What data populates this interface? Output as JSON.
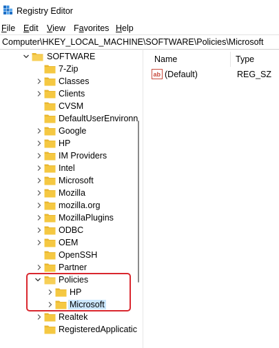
{
  "window": {
    "title": "Registry Editor"
  },
  "menu": [
    {
      "underline": "F",
      "rest": "ile"
    },
    {
      "underline": "E",
      "rest": "dit"
    },
    {
      "underline": "V",
      "rest": "iew"
    },
    {
      "prefix": "F",
      "underline": "a",
      "rest": "vorites"
    },
    {
      "underline": "H",
      "rest": "elp"
    }
  ],
  "address": {
    "path": "Computer\\HKEY_LOCAL_MACHINE\\SOFTWARE\\Policies\\Microsoft"
  },
  "tree": {
    "software": "SOFTWARE",
    "items": [
      {
        "label": "7-Zip",
        "expandable": false
      },
      {
        "label": "Classes",
        "expandable": true
      },
      {
        "label": "Clients",
        "expandable": true
      },
      {
        "label": "CVSM",
        "expandable": false
      },
      {
        "label": "DefaultUserEnvironn",
        "expandable": false
      },
      {
        "label": "Google",
        "expandable": true
      },
      {
        "label": "HP",
        "expandable": true
      },
      {
        "label": "IM Providers",
        "expandable": true
      },
      {
        "label": "Intel",
        "expandable": true
      },
      {
        "label": "Microsoft",
        "expandable": true
      },
      {
        "label": "Mozilla",
        "expandable": true
      },
      {
        "label": "mozilla.org",
        "expandable": true
      },
      {
        "label": "MozillaPlugins",
        "expandable": true
      },
      {
        "label": "ODBC",
        "expandable": true
      },
      {
        "label": "OEM",
        "expandable": true
      },
      {
        "label": "OpenSSH",
        "expandable": false
      },
      {
        "label": "Partner",
        "expandable": true
      },
      {
        "label": "Policies",
        "expandable": true,
        "expanded": true
      },
      {
        "label": "HP",
        "expandable": true,
        "child": true
      },
      {
        "label": "Microsoft",
        "expandable": true,
        "child": true,
        "selected": true
      },
      {
        "label": "Realtek",
        "expandable": true
      },
      {
        "label": "RegisteredApplicatic",
        "expandable": false
      }
    ]
  },
  "values": {
    "headers": {
      "name": "Name",
      "type": "Type"
    },
    "rows": [
      {
        "name": "(Default)",
        "type": "REG_SZ",
        "icon": "string-value-icon"
      }
    ]
  },
  "colors": {
    "folder": "#f4c542",
    "selection": "#cce8ff",
    "highlight": "#d9262d"
  }
}
